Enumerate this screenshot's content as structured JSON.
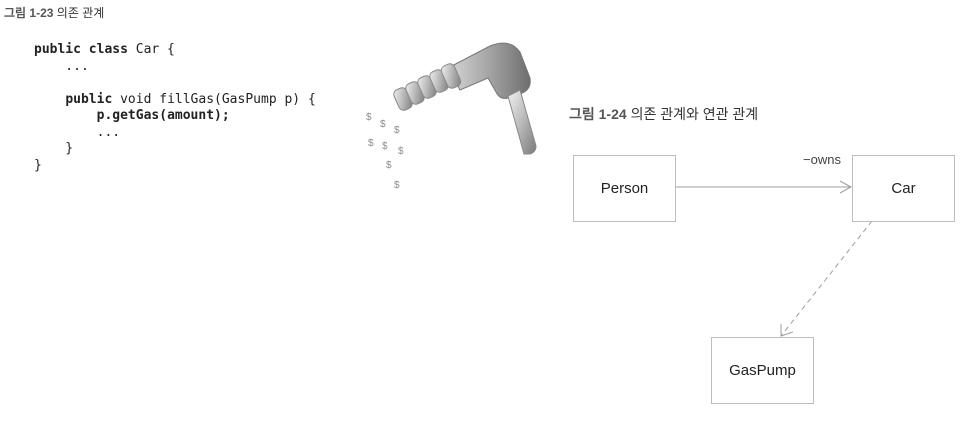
{
  "figure1": {
    "caption_num": "그림 1-23",
    "caption_text": "의존 관계",
    "code": {
      "line1_kw": "public class",
      "line1_rest": " Car {",
      "line2": "    ...",
      "line3": "",
      "line4_kw": "public",
      "line4_rest": " void fillGas(GasPump p) {",
      "line5_bold": "p.getGas(amount);",
      "line6": "        ...",
      "line7": "    }",
      "line8": "}"
    },
    "illustration": {
      "icon": "gas-nozzle-icon",
      "dollar_sign": "$"
    }
  },
  "figure2": {
    "caption_num": "그림 1-24",
    "caption_text": "의존 관계와 연관 관계",
    "classes": {
      "person": "Person",
      "car": "Car",
      "gaspump": "GasPump"
    },
    "association_label": "−owns",
    "colors": {
      "line": "#9e9e9e",
      "box_border": "#bdbdbd"
    }
  }
}
